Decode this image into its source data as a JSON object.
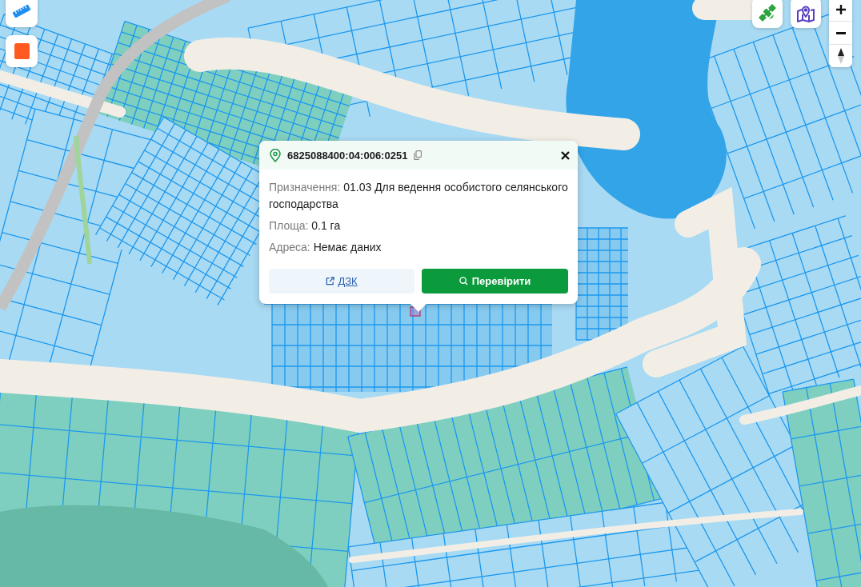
{
  "parcel_popup": {
    "cadastral_number": "6825088400:04:006:0251",
    "fields": [
      {
        "label": "Призначення:",
        "value": "01.03 Для ведення особистого селянського господарства"
      },
      {
        "label": "Площа:",
        "value": "0.1 га"
      },
      {
        "label": "Адреса:",
        "value": "Немає даних"
      }
    ],
    "actions": [
      {
        "kind": "link",
        "label": "ДЗК"
      },
      {
        "kind": "primary",
        "label": "Перевірити"
      }
    ]
  }
}
